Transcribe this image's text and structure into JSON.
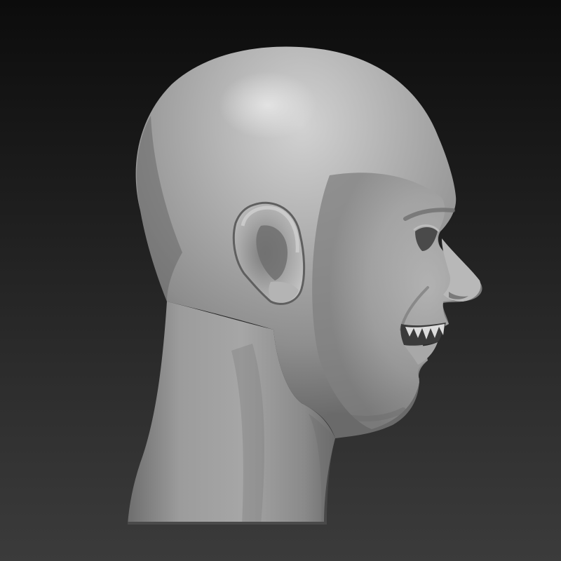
{
  "scene": {
    "subject_icon": "sculpted-head-profile-icon",
    "colors": {
      "background_top": "#0c0c0c",
      "background_bottom": "#3b3b3b",
      "clay_light": "#c4c4c4",
      "clay_mid": "#9a9a9a",
      "clay_shadow": "#5a5a5a",
      "teeth": "#e8e4da"
    }
  }
}
